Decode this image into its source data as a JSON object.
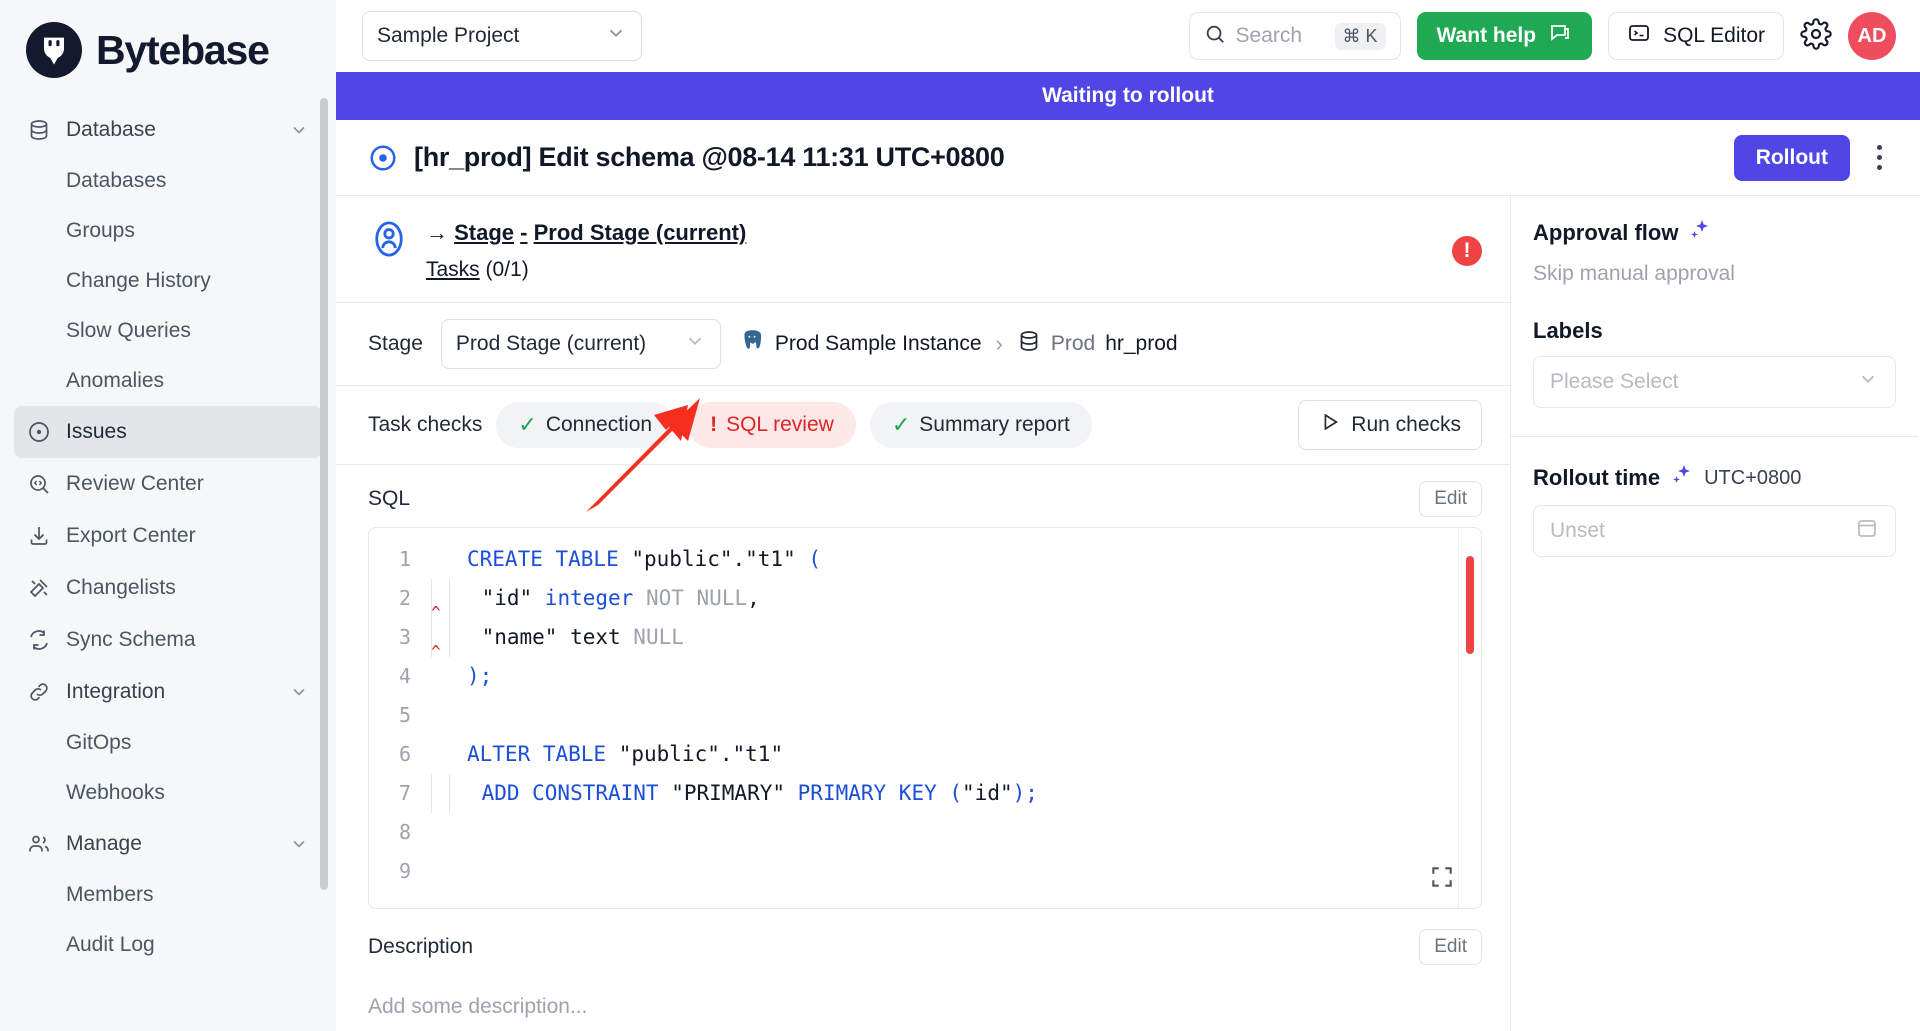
{
  "brand": {
    "name": "Bytebase",
    "logo_icon": "bytebase-logo-icon"
  },
  "sidebar": {
    "items": [
      {
        "label": "Database",
        "icon": "database-icon",
        "type": "group",
        "expanded": true
      },
      {
        "label": "Databases",
        "type": "sub"
      },
      {
        "label": "Groups",
        "type": "sub"
      },
      {
        "label": "Change History",
        "type": "sub"
      },
      {
        "label": "Slow Queries",
        "type": "sub"
      },
      {
        "label": "Anomalies",
        "type": "sub"
      },
      {
        "label": "Issues",
        "icon": "issues-icon",
        "type": "item",
        "active": true
      },
      {
        "label": "Review Center",
        "icon": "review-center-icon",
        "type": "item"
      },
      {
        "label": "Export Center",
        "icon": "export-center-icon",
        "type": "item"
      },
      {
        "label": "Changelists",
        "icon": "changelists-icon",
        "type": "item"
      },
      {
        "label": "Sync Schema",
        "icon": "sync-schema-icon",
        "type": "item"
      },
      {
        "label": "Integration",
        "icon": "integration-icon",
        "type": "group",
        "expanded": true
      },
      {
        "label": "GitOps",
        "type": "sub"
      },
      {
        "label": "Webhooks",
        "type": "sub"
      },
      {
        "label": "Manage",
        "icon": "manage-icon",
        "type": "group",
        "expanded": true
      },
      {
        "label": "Members",
        "type": "sub"
      },
      {
        "label": "Audit Log",
        "type": "sub"
      }
    ]
  },
  "header": {
    "project_selector": "Sample Project",
    "search_placeholder": "Search",
    "search_shortcut": "⌘ K",
    "want_help_label": "Want help",
    "sql_editor_label": "SQL Editor",
    "settings_icon": "gear-icon",
    "avatar_initials": "AD",
    "avatar_color": "#ef4d5e"
  },
  "issue": {
    "banner_text": "Waiting to rollout",
    "banner_color": "#4f46e5",
    "title": "[hr_prod] Edit schema @08-14 11:31 UTC+0800",
    "rollout_label": "Rollout",
    "status_icon": "issue-open-icon"
  },
  "stage": {
    "arrow": "→",
    "prefix": "Stage",
    "dash": "-",
    "name": "Prod Stage (current)",
    "tasks_label": "Tasks",
    "tasks_count": "(0/1)",
    "error_badge": "!",
    "stage_field_label": "Stage",
    "stage_select_value": "Prod Stage (current)",
    "breadcrumb": {
      "instance_icon": "postgres-icon",
      "instance": "Prod Sample Instance",
      "separator": "›",
      "database_icon": "database-icon",
      "env": "Prod",
      "database": "hr_prod"
    }
  },
  "task_checks": {
    "label": "Task checks",
    "chips": [
      {
        "label": "Connection",
        "state": "pass",
        "glyph": "✓"
      },
      {
        "label": "SQL review",
        "state": "fail",
        "glyph": "!"
      },
      {
        "label": "Summary report",
        "state": "pass",
        "glyph": "✓"
      }
    ],
    "run_checks_label": "Run checks",
    "run_icon": "play-icon"
  },
  "sql_section": {
    "title": "SQL",
    "edit_label": "Edit",
    "expand_icon": "expand-icon",
    "lines": [
      {
        "n": "1",
        "indent": 0,
        "tokens": [
          {
            "t": "CREATE TABLE",
            "c": "kw"
          },
          {
            "t": " \"public\".\"t1\" ",
            "c": ""
          },
          {
            "t": "(",
            "c": "kw"
          }
        ]
      },
      {
        "n": "2",
        "indent": 1,
        "squiggle": true,
        "tokens": [
          {
            "t": "    \"id\" ",
            "c": ""
          },
          {
            "t": "integer",
            "c": "ty"
          },
          {
            "t": " ",
            "c": ""
          },
          {
            "t": "NOT NULL",
            "c": "nl"
          },
          {
            "t": ",",
            "c": ""
          }
        ]
      },
      {
        "n": "3",
        "indent": 1,
        "squiggle": true,
        "tokens": [
          {
            "t": "    \"name\" text ",
            "c": ""
          },
          {
            "t": "NULL",
            "c": "nl"
          }
        ]
      },
      {
        "n": "4",
        "indent": 0,
        "tokens": [
          {
            "t": ");",
            "c": "kw"
          }
        ]
      },
      {
        "n": "5",
        "indent": 0,
        "tokens": []
      },
      {
        "n": "6",
        "indent": 0,
        "tokens": [
          {
            "t": "ALTER TABLE",
            "c": "kw"
          },
          {
            "t": " \"public\".\"t1\"",
            "c": ""
          }
        ]
      },
      {
        "n": "7",
        "indent": 1,
        "tokens": [
          {
            "t": "    ADD CONSTRAINT",
            "c": "kw"
          },
          {
            "t": " \"PRIMARY\" ",
            "c": ""
          },
          {
            "t": "PRIMARY KEY",
            "c": "kw"
          },
          {
            "t": " (",
            "c": "kw"
          },
          {
            "t": "\"id\"",
            "c": ""
          },
          {
            "t": ");",
            "c": "kw"
          }
        ]
      },
      {
        "n": "8",
        "indent": 0,
        "tokens": []
      },
      {
        "n": "9",
        "indent": 0,
        "tokens": []
      }
    ]
  },
  "description_section": {
    "title": "Description",
    "edit_label": "Edit",
    "placeholder": "Add some description..."
  },
  "right_panel": {
    "approval_flow_title": "Approval flow",
    "approval_flow_value": "Skip manual approval",
    "labels_title": "Labels",
    "labels_placeholder": "Please Select",
    "rollout_time_title": "Rollout time",
    "rollout_time_tz": "UTC+0800",
    "rollout_time_value": "Unset",
    "calendar_icon": "calendar-icon",
    "sparkle_icon": "sparkles-icon"
  },
  "annotation": {
    "type": "red-arrow",
    "points_to": "SQL review"
  }
}
